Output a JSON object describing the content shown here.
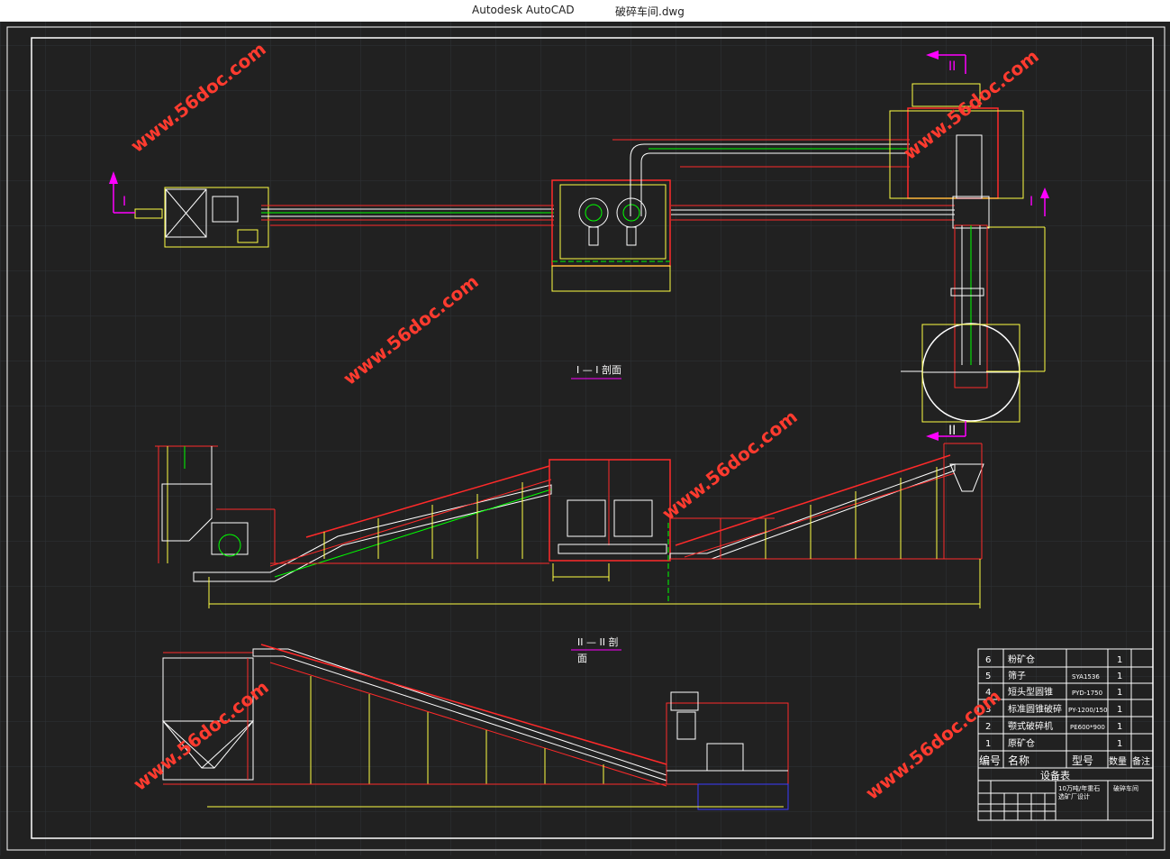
{
  "window": {
    "app_title": "Autodesk AutoCAD",
    "doc_title": "破碎车间.dwg"
  },
  "drawing": {
    "section1_marker_left": "I",
    "section1_marker_right": "I",
    "section2_marker_top": "II",
    "section2_marker_bottom": "II",
    "section1_title": "I — I 剖面",
    "section2_title_a": "II — II 剖",
    "section2_title_b": "面",
    "watermark": "www.56doc.com"
  },
  "table": {
    "rows": [
      {
        "no": "6",
        "name": "粉矿仓",
        "model": "",
        "qty": "1"
      },
      {
        "no": "5",
        "name": "筛子",
        "model": "SYA1536",
        "qty": "1"
      },
      {
        "no": "4",
        "name": "短头型圆锥",
        "model": "PYD-1750",
        "qty": "1"
      },
      {
        "no": "3",
        "name": "标准圆锥破碎",
        "model": "PY-1200/150",
        "qty": "1"
      },
      {
        "no": "2",
        "name": "颚式破碎机",
        "model": "PE600*900",
        "qty": "1"
      },
      {
        "no": "1",
        "name": "原矿仓",
        "model": "",
        "qty": "1"
      }
    ],
    "header": {
      "no": "编号",
      "name": "名称",
      "model": "型号",
      "qty": "数量",
      "note": "备注"
    },
    "caption": "设备表",
    "titleblock_a": "10万吨/年重石",
    "titleblock_b": "选矿厂设计",
    "titleblock_c": "破碎车间"
  },
  "colors": {
    "background": "#212121",
    "red": "#ff2a2a",
    "yellow": "#ffff44",
    "white": "#ffffff",
    "green": "#00ff00",
    "magenta": "#ff00ff",
    "blue": "#3a3aff"
  }
}
